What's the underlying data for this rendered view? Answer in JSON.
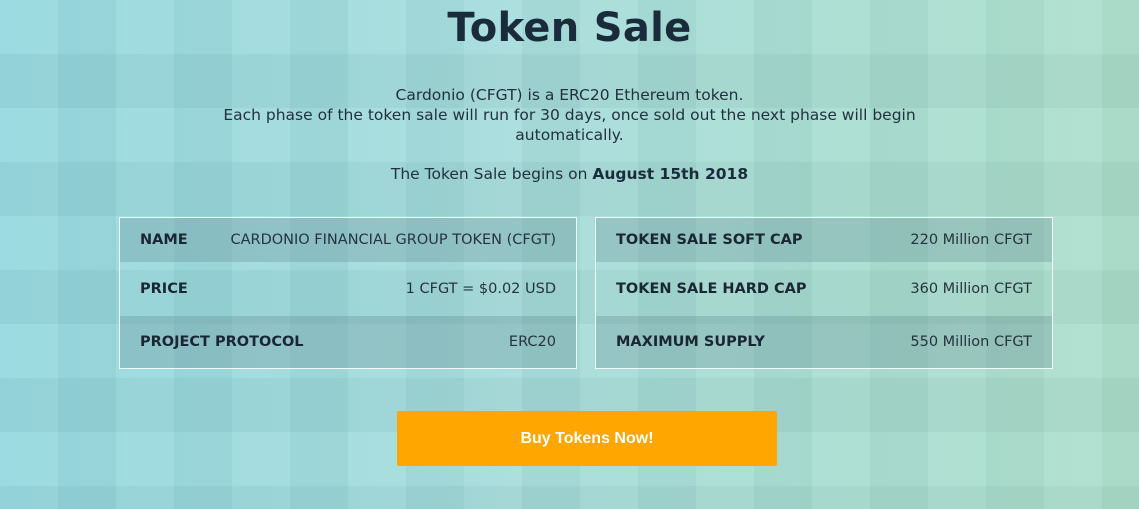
{
  "section": {
    "title": "Token Sale",
    "intro_line1": "Cardonio (CFGT) is a ERC20 Ethereum token.",
    "intro_line2": "Each phase of the token sale will run for 30 days, once sold out the next phase will begin automatically.",
    "begins_prefix": "The Token Sale begins on ",
    "begins_date": "August 15th 2018"
  },
  "left_table": {
    "rows": [
      {
        "key": "NAME",
        "value": "CARDONIO FINANCIAL GROUP TOKEN (CFGT)"
      },
      {
        "key": "PRICE",
        "value": "1 CFGT = $0.02 USD"
      },
      {
        "key": "PROJECT PROTOCOL",
        "value": "ERC20"
      }
    ]
  },
  "right_table": {
    "rows": [
      {
        "key": "TOKEN SALE SOFT CAP",
        "value": "220 Million CFGT"
      },
      {
        "key": "TOKEN SALE HARD CAP",
        "value": "360 Million CFGT"
      },
      {
        "key": "MAXIMUM SUPPLY",
        "value": "550 Million CFGT"
      }
    ]
  },
  "cta": {
    "label": "Buy Tokens Now!"
  },
  "colors": {
    "accent": "#ffa600",
    "heading": "#1a2b3c"
  }
}
